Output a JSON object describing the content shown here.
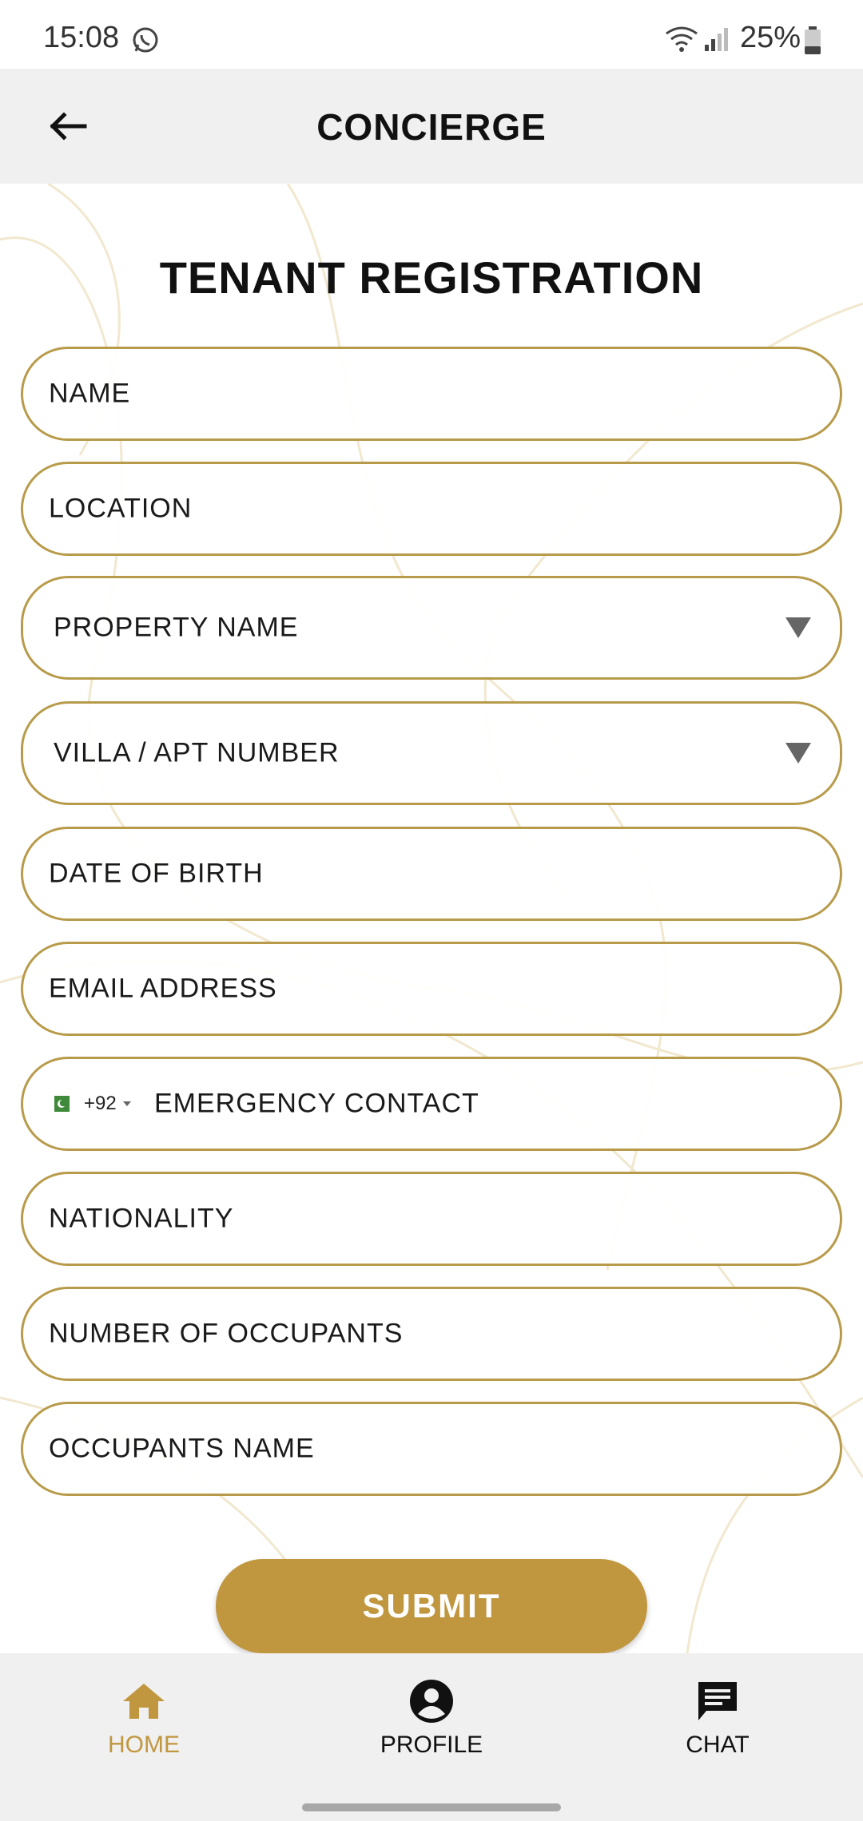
{
  "status_bar": {
    "time": "15:08",
    "battery": "25%",
    "icons": [
      "whatsapp-icon",
      "wifi-icon",
      "signal-icon",
      "battery-icon"
    ]
  },
  "app_bar": {
    "back_icon": "back-arrow-icon",
    "title": "CONCIERGE"
  },
  "form": {
    "heading": "TENANT REGISTRATION",
    "name_placeholder": "NAME",
    "location_placeholder": "LOCATION",
    "property_name_label": "PROPERTY NAME",
    "unit_number_label": "VILLA / APT NUMBER",
    "dob_placeholder": "DATE OF BIRTH",
    "email_placeholder": "EMAIL ADDRESS",
    "emergency_contact": {
      "country_code": "+92",
      "flag": "pakistan-flag-icon",
      "placeholder": "EMERGENCY CONTACT"
    },
    "nationality_placeholder": "NATIONALITY",
    "occupants_count_placeholder": "NUMBER OF OCCUPANTS",
    "occupants_name_placeholder": "OCCUPANTS NAME",
    "submit_label": "SUBMIT"
  },
  "bottom_nav": {
    "items": [
      {
        "label": "HOME",
        "icon": "home-icon",
        "active": true
      },
      {
        "label": "PROFILE",
        "icon": "account-circle-icon",
        "active": false
      },
      {
        "label": "CHAT",
        "icon": "chat-icon",
        "active": false
      }
    ]
  },
  "colors": {
    "accent": "#c0973f",
    "field_border": "#b89b4a",
    "app_bar_bg": "#f0f0f0",
    "text": "#1a1a1a"
  }
}
